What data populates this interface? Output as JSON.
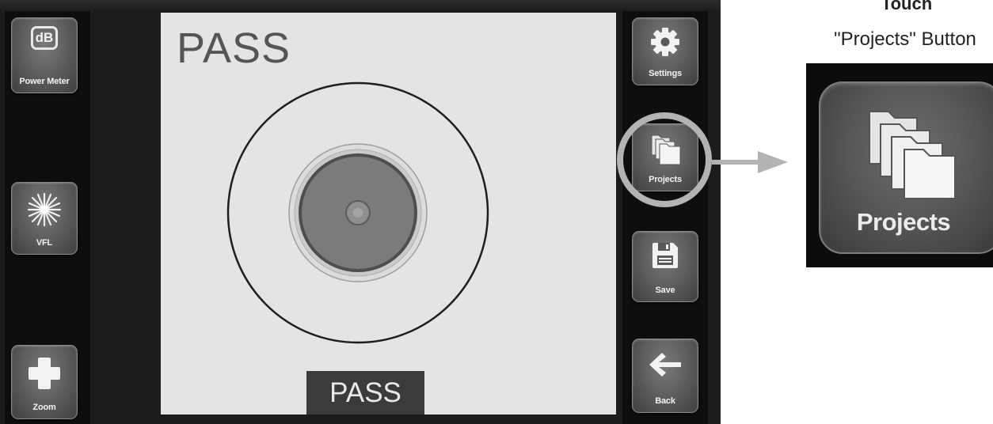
{
  "device": {
    "left_toolbar": [
      {
        "label": "Power Meter",
        "icon": "db-icon",
        "icon_text": "dB"
      },
      {
        "label": "VFL",
        "icon": "laser-burst-icon"
      },
      {
        "label": "Zoom",
        "icon": "plus-icon"
      }
    ],
    "right_toolbar": [
      {
        "label": "Settings",
        "icon": "gear-icon"
      },
      {
        "label": "Projects",
        "icon": "folders-icon"
      },
      {
        "label": "Save",
        "icon": "floppy-disk-icon"
      },
      {
        "label": "Back",
        "icon": "back-arrow-icon"
      }
    ],
    "screen": {
      "result_heading": "PASS",
      "result_banner": "PASS"
    }
  },
  "instruction": {
    "title": "Touch",
    "subtitle": "\"Projects\" Button"
  },
  "zoom_callout": {
    "label": "Projects",
    "icon": "folders-icon"
  },
  "colors": {
    "device_body": "#1c1c1c",
    "screen_background": "#e4e4e4",
    "button_face": "#5a5a5a",
    "callout": "#b3b3b3"
  }
}
